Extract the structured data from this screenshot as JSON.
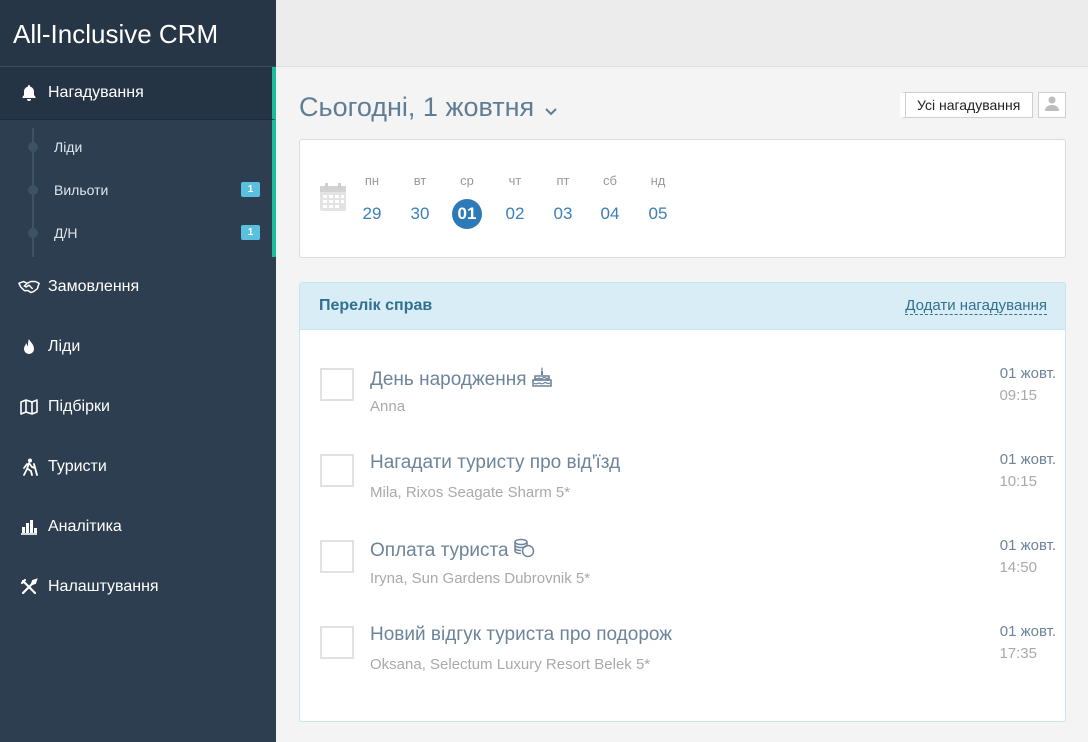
{
  "brand": "All-Inclusive CRM",
  "sidebar": {
    "active": {
      "label": "Нагадування",
      "icon": "bell-icon"
    },
    "subitems": [
      {
        "label": "Ліди",
        "badge": ""
      },
      {
        "label": "Вильоти",
        "badge": "1"
      },
      {
        "label": "Д/Н",
        "badge": "1"
      }
    ],
    "items": [
      {
        "label": "Замовлення",
        "icon": "handshake-icon"
      },
      {
        "label": "Ліди",
        "icon": "fire-icon"
      },
      {
        "label": "Підбірки",
        "icon": "map-icon"
      },
      {
        "label": "Туристи",
        "icon": "hiker-icon"
      },
      {
        "label": "Аналітика",
        "icon": "bar-chart-icon"
      },
      {
        "label": "Налаштування",
        "icon": "tools-icon"
      }
    ]
  },
  "header": {
    "title": "Сьогодні, 1 жовтня",
    "all_reminders": "Усі нагадування"
  },
  "calendar": {
    "days": [
      {
        "name": "пн",
        "date": "29"
      },
      {
        "name": "вт",
        "date": "30"
      },
      {
        "name": "ср",
        "date": "01",
        "selected": true
      },
      {
        "name": "чт",
        "date": "02"
      },
      {
        "name": "пт",
        "date": "03"
      },
      {
        "name": "сб",
        "date": "04"
      },
      {
        "name": "нд",
        "date": "05"
      }
    ]
  },
  "tasks": {
    "title": "Перелік справ",
    "add_label": "Додати нагадування",
    "items": [
      {
        "title": "День народження",
        "icon": "cake-icon",
        "subtitle": "Anna",
        "date": "01 жовт.",
        "time": "09:15"
      },
      {
        "title": "Нагадати туристу про від'їзд",
        "icon": "",
        "subtitle": "Mila, Rixos Seagate Sharm 5*",
        "date": "01 жовт.",
        "time": "10:15"
      },
      {
        "title": "Оплата туриста",
        "icon": "coins-icon",
        "subtitle": "Iryna, Sun Gardens Dubrovnik 5*",
        "date": "01 жовт.",
        "time": "14:50"
      },
      {
        "title": "Новий відгук туриста про подорож",
        "icon": "",
        "subtitle": "Oksana, Selectum Luxury Resort Belek 5*",
        "date": "01 жовт.",
        "time": "17:35"
      }
    ]
  }
}
